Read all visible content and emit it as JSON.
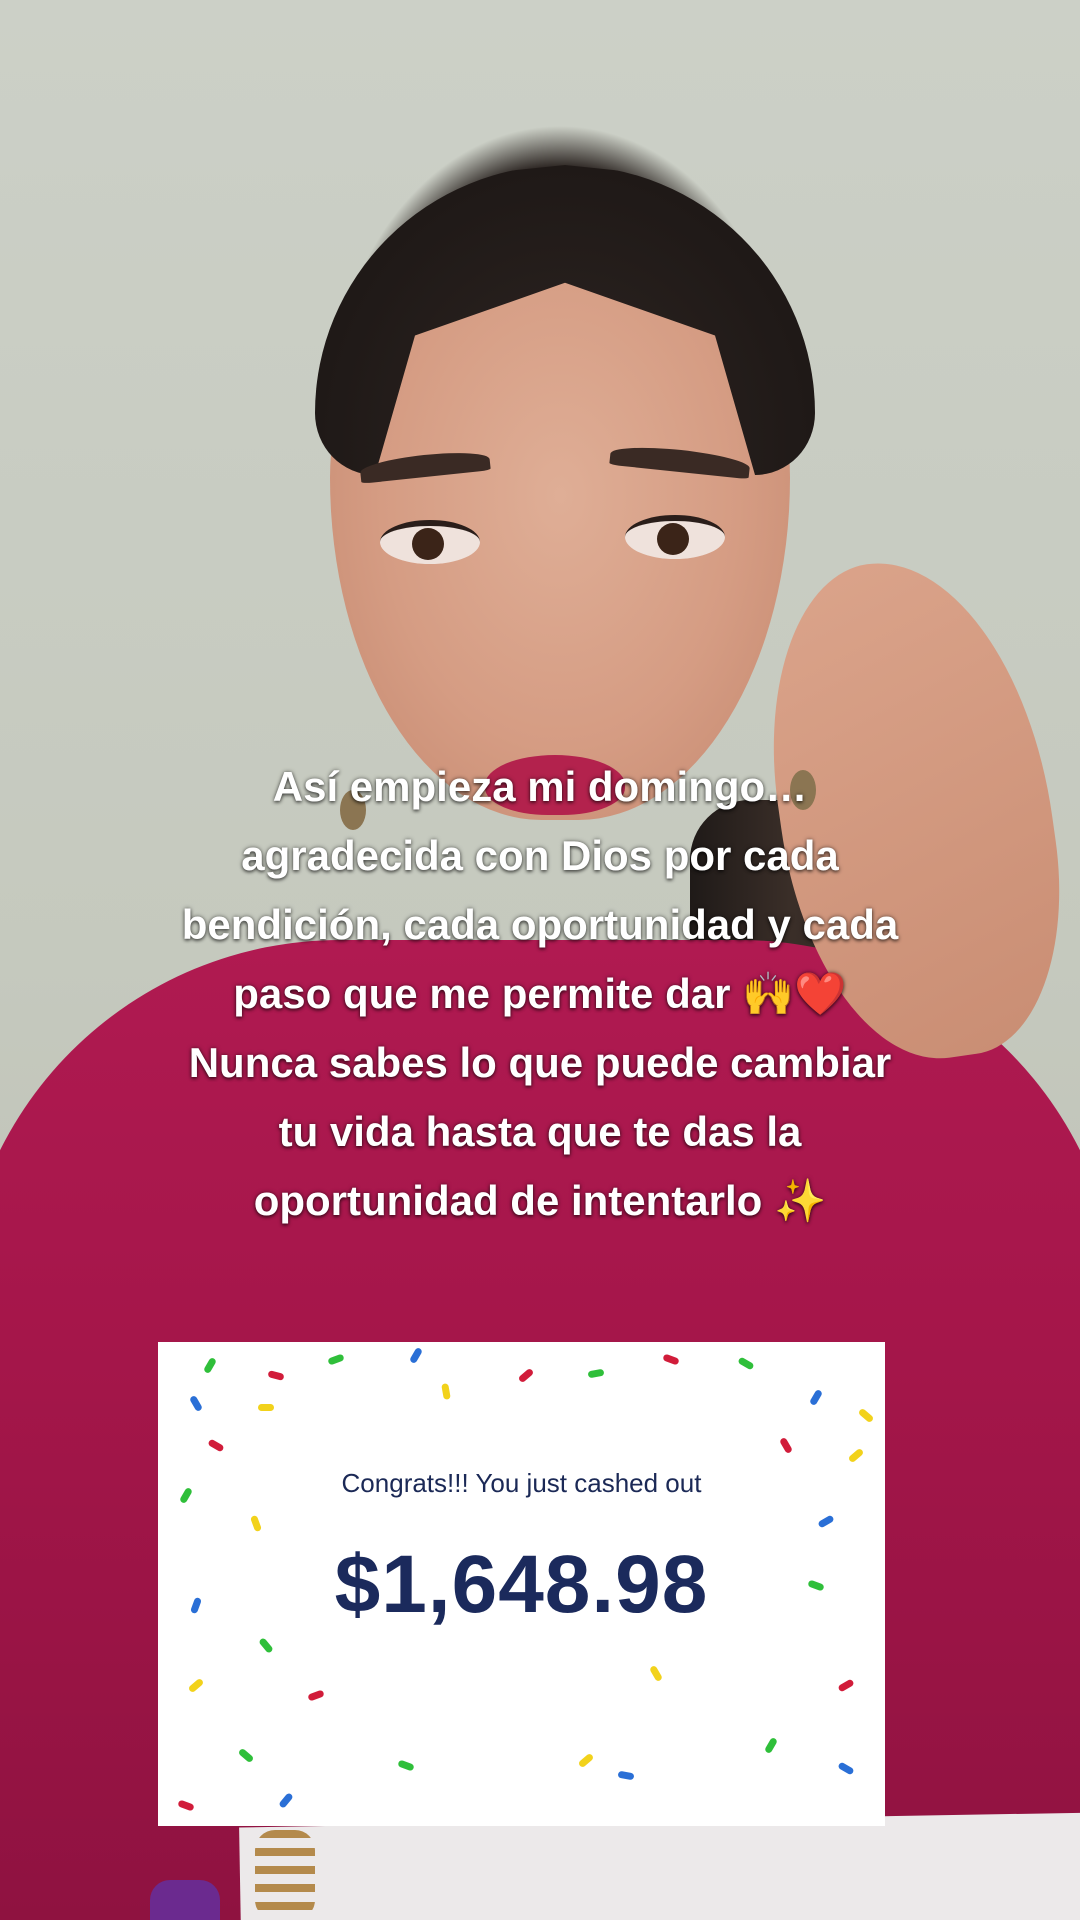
{
  "caption": {
    "lines": [
      "Así empieza mi domingo…",
      "agradecida con Dios por cada",
      "bendición, cada oportunidad y cada",
      "paso que me permite dar 🙌❤️",
      "Nunca sabes lo que puede cambiar",
      "tu vida hasta que te das la",
      "oportunidad de intentarlo ✨"
    ]
  },
  "card": {
    "message": "Congrats!!! You just cashed out",
    "amount": "$1,648.98",
    "confetti_colors": [
      "#2fbf3a",
      "#f2d21b",
      "#2a6fd6",
      "#d11c3a"
    ]
  }
}
